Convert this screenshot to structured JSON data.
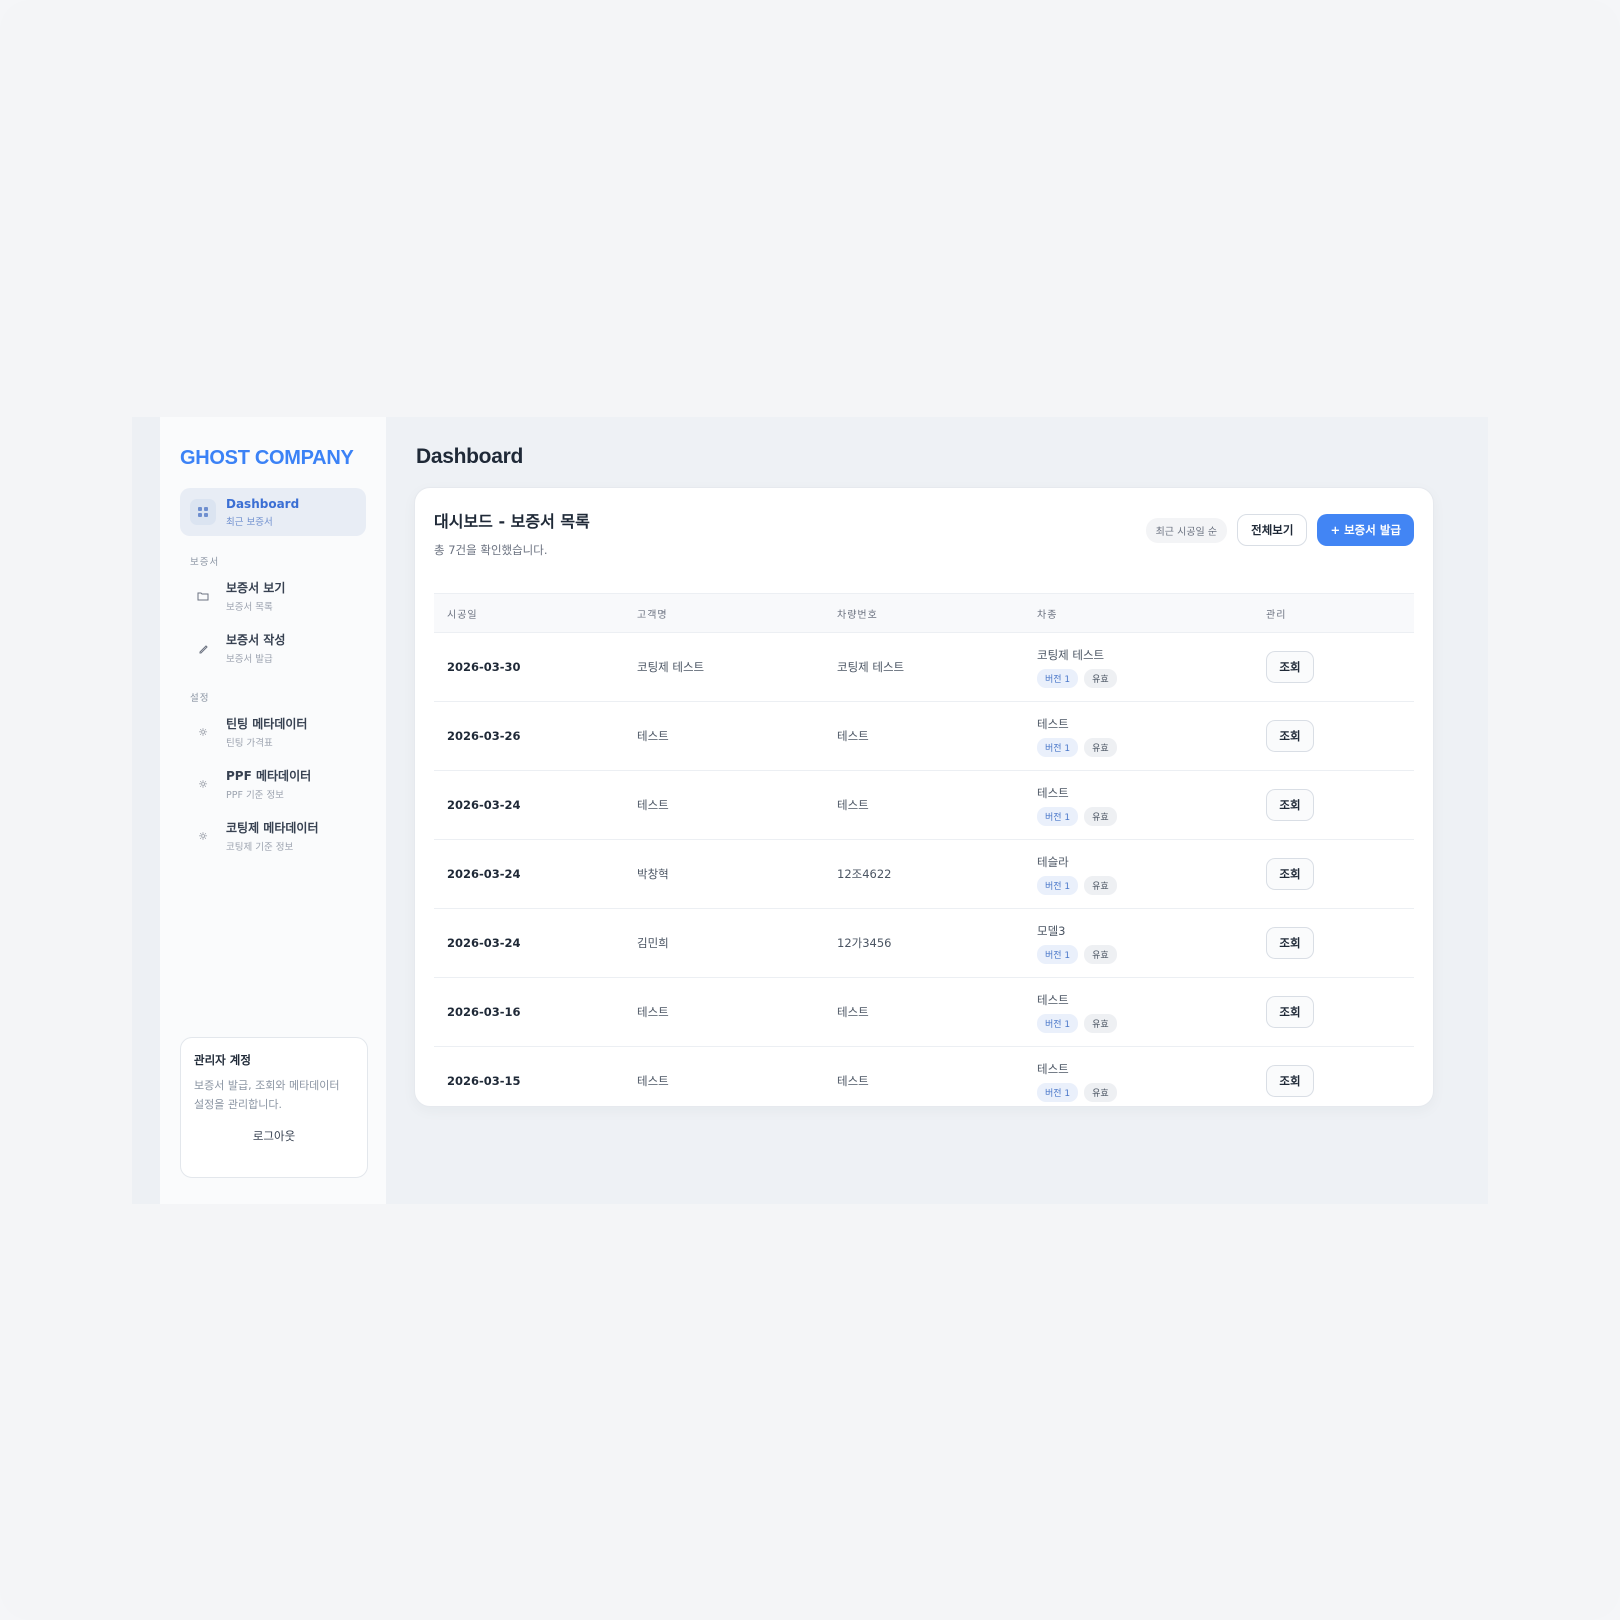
{
  "brand": {
    "name": "GHOST COMPANY"
  },
  "page": {
    "title": "Dashboard"
  },
  "sidebar": {
    "active": {
      "label": "Dashboard",
      "sub": "최근 보증서",
      "icon": "grid-icon"
    },
    "sections": [
      {
        "label": "보증서",
        "items": [
          {
            "label": "보증서 보기",
            "sub": "보증서 목록",
            "icon": "folder-icon"
          },
          {
            "label": "보증서 작성",
            "sub": "보증서 발급",
            "icon": "pencil-icon"
          }
        ]
      },
      {
        "label": "설정",
        "items": [
          {
            "label": "틴팅 메타데이터",
            "sub": "틴팅 가격표",
            "icon": "gear-icon"
          },
          {
            "label": "PPF 메타데이터",
            "sub": "PPF 기준 정보",
            "icon": "gear-icon"
          },
          {
            "label": "코팅제 메타데이터",
            "sub": "코팅제 기준 정보",
            "icon": "gear-icon"
          }
        ]
      }
    ]
  },
  "admin": {
    "title": "관리자 계정",
    "desc_line1": "보증서 발급, 조회와 메타데이터",
    "desc_line2": "설정을 관리합니다.",
    "logout": "로그아웃"
  },
  "card": {
    "title": "대시보드 - 보증서 목록",
    "count": "총 7건을 확인했습니다.",
    "sort": "최근 시공일 순",
    "view_all": "전체보기",
    "issue": "+ 보증서 발급"
  },
  "table": {
    "headers": [
      "시공일",
      "고객명",
      "차량번호",
      "차종",
      "관리"
    ],
    "rows": [
      {
        "date": "2026-03-30",
        "customer": "코팅제 테스트",
        "plate": "코팅제 테스트",
        "model": "코팅제 테스트",
        "version": "버전 1",
        "status": "유효",
        "action": "조회"
      },
      {
        "date": "2026-03-26",
        "customer": "테스트",
        "plate": "테스트",
        "model": "테스트",
        "version": "버전 1",
        "status": "유효",
        "action": "조회"
      },
      {
        "date": "2026-03-24",
        "customer": "테스트",
        "plate": "테스트",
        "model": "테스트",
        "version": "버전 1",
        "status": "유효",
        "action": "조회"
      },
      {
        "date": "2026-03-24",
        "customer": "박창혁",
        "plate": "12조4622",
        "model": "테슬라",
        "version": "버전 1",
        "status": "유효",
        "action": "조회"
      },
      {
        "date": "2026-03-24",
        "customer": "김민희",
        "plate": "12가3456",
        "model": "모델3",
        "version": "버전 1",
        "status": "유효",
        "action": "조회"
      },
      {
        "date": "2026-03-16",
        "customer": "테스트",
        "plate": "테스트",
        "model": "테스트",
        "version": "버전 1",
        "status": "유효",
        "action": "조회"
      },
      {
        "date": "2026-03-15",
        "customer": "테스트",
        "plate": "테스트",
        "model": "테스트",
        "version": "버전 1",
        "status": "유효",
        "action": "조회"
      }
    ]
  },
  "colors": {
    "accent": "#4285f4",
    "brand": "#3b82f6",
    "background": "#f4f5f7"
  }
}
